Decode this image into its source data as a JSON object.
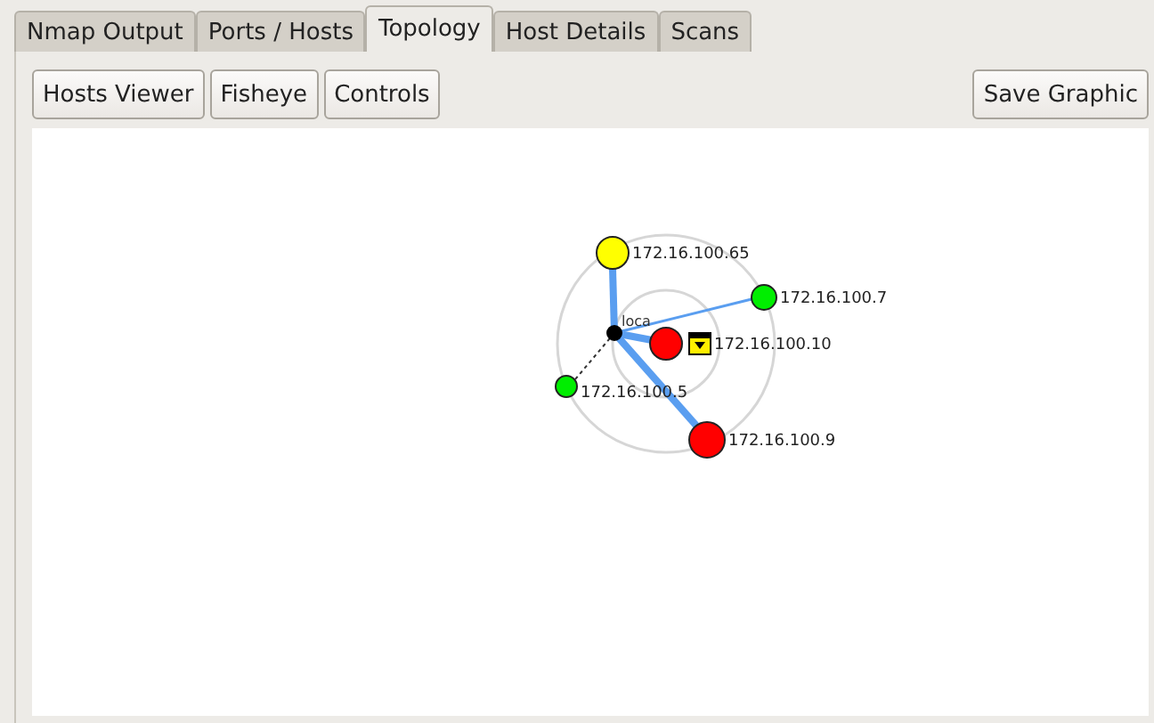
{
  "tabs": [
    {
      "label": "Nmap Output",
      "selected": false
    },
    {
      "label": "Ports / Hosts",
      "selected": false
    },
    {
      "label": "Topology",
      "selected": true
    },
    {
      "label": "Host Details",
      "selected": false
    },
    {
      "label": "Scans",
      "selected": false
    }
  ],
  "toolbar": {
    "left_buttons": [
      "Hosts Viewer",
      "Fisheye",
      "Controls"
    ],
    "right_button": "Save Graphic"
  },
  "topology": {
    "center_label": "loca",
    "nodes": [
      {
        "label": "172.16.100.65",
        "color": "#ffff00"
      },
      {
        "label": "172.16.100.7",
        "color": "#00ee00"
      },
      {
        "label": "172.16.100.10",
        "color": "#ff0000"
      },
      {
        "label": "172.16.100.5",
        "color": "#00ee00"
      },
      {
        "label": "172.16.100.9",
        "color": "#ff0000"
      }
    ]
  }
}
